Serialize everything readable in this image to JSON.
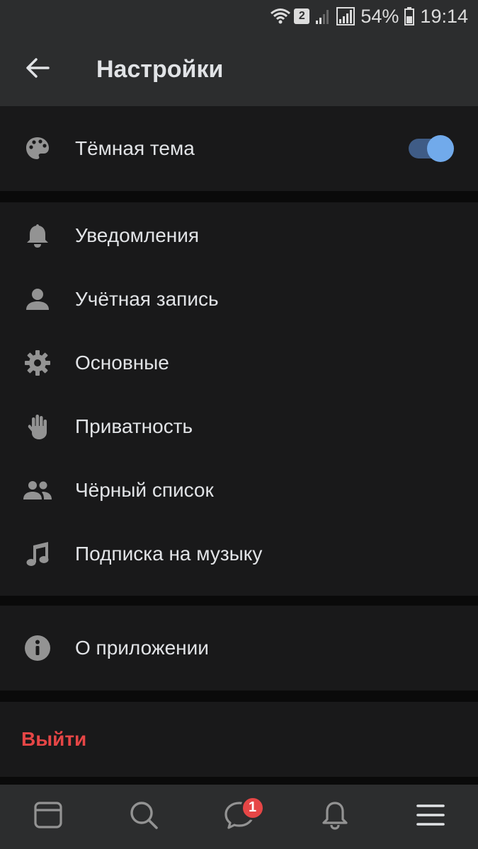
{
  "status_bar": {
    "sim_badge": "2",
    "battery": "54%",
    "time": "19:14"
  },
  "header": {
    "title": "Настройки"
  },
  "settings": {
    "theme": {
      "label": "Тёмная тема",
      "icon": "palette-icon",
      "enabled": true
    },
    "main_items": [
      {
        "label": "Уведомления",
        "icon": "bell-icon"
      },
      {
        "label": "Учётная запись",
        "icon": "person-icon"
      },
      {
        "label": "Основные",
        "icon": "gear-icon"
      },
      {
        "label": "Приватность",
        "icon": "hand-icon"
      },
      {
        "label": "Чёрный список",
        "icon": "people-icon"
      },
      {
        "label": "Подписка на музыку",
        "icon": "music-note-icon"
      }
    ],
    "about": {
      "label": "О приложении",
      "icon": "info-icon"
    },
    "logout": {
      "label": "Выйти"
    }
  },
  "tab_bar": {
    "messages_badge": "1",
    "tabs": [
      "news-icon",
      "search-icon",
      "messages-icon",
      "notifications-icon",
      "menu-icon"
    ]
  },
  "colors": {
    "background": "#0a0a0a",
    "surface": "#19191a",
    "header": "#2c2d2e",
    "accent": "#71aaeb",
    "danger": "#e64646",
    "icon": "#939393"
  }
}
